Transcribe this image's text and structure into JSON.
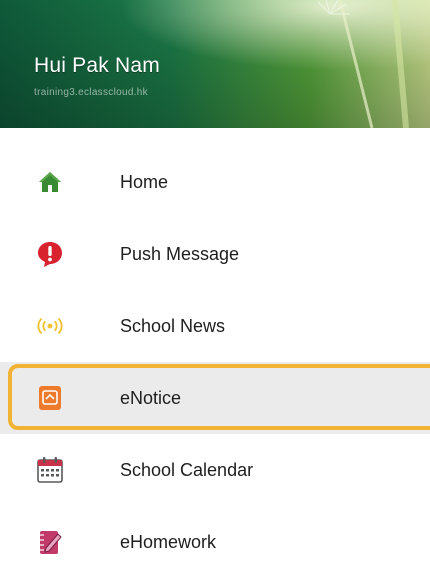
{
  "header": {
    "user_name": "Hui Pak Nam",
    "user_email": "training3.eclasscloud.hk"
  },
  "menu": {
    "items": [
      {
        "label": "Home",
        "icon": "home-icon",
        "color": "#3a8a34"
      },
      {
        "label": "Push Message",
        "icon": "alert-icon",
        "color": "#d8232f"
      },
      {
        "label": "School News",
        "icon": "broadcast-icon",
        "color": "#f1c232"
      },
      {
        "label": "eNotice",
        "icon": "notice-icon",
        "color": "#ef7a2b",
        "selected": true
      },
      {
        "label": "School Calendar",
        "icon": "calendar-icon",
        "color": "#c8324a"
      },
      {
        "label": "eHomework",
        "icon": "homework-icon",
        "color": "#c23a6a"
      }
    ]
  },
  "colors": {
    "highlight": "#f2b233",
    "selected_background": "#ebebeb"
  }
}
